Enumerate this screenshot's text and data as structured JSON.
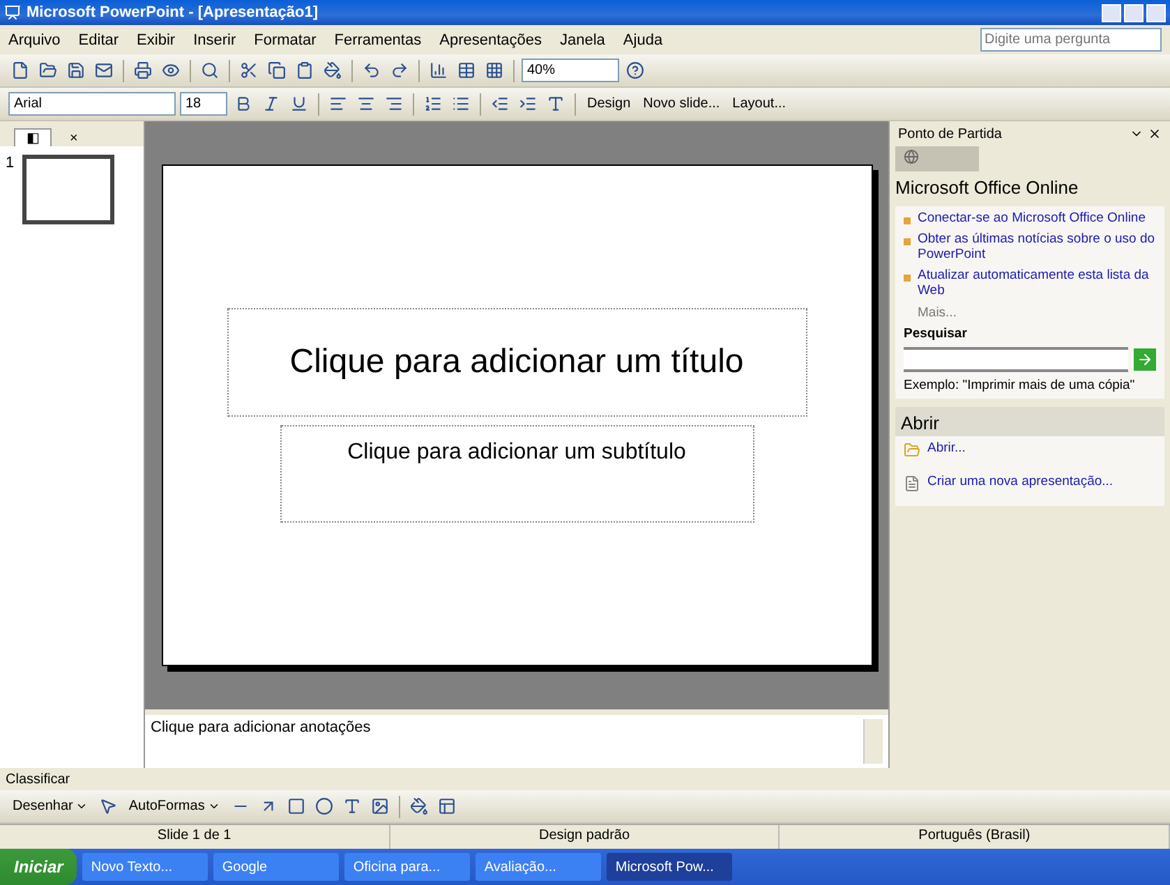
{
  "window": {
    "title": "Microsoft PowerPoint - [Apresentação1]"
  },
  "menu": [
    "Arquivo",
    "Editar",
    "Exibir",
    "Inserir",
    "Formatar",
    "Ferramentas",
    "Apresentações",
    "Janela",
    "Ajuda"
  ],
  "help_box": {
    "placeholder": "Digite uma pergunta"
  },
  "standard_toolbar": {
    "zoom": "40%"
  },
  "formatting_toolbar": {
    "font": "Arial",
    "size": "18",
    "buttons": [
      "Design",
      "Novo slide...",
      "Layout..."
    ]
  },
  "slides_pane": {
    "tabs": [
      {
        "label": "◧",
        "selected": true
      },
      {
        "label": "×",
        "selected": false
      }
    ],
    "slide_number": "1"
  },
  "slide": {
    "title": "Clique para adicionar um título",
    "subtitle": "Clique para adicionar um subtítulo"
  },
  "notes": {
    "placeholder": "Clique para adicionar anotações"
  },
  "task_pane": {
    "title": "Ponto de Partida",
    "heading": "Microsoft Office Online",
    "links": [
      "Conectar-se ao Microsoft Office Online",
      "Obter as últimas notícias sobre o uso do PowerPoint",
      "Atualizar automaticamente esta lista da Web"
    ],
    "more": "Mais...",
    "search_label": "Pesquisar",
    "example": "Exemplo: \"Imprimir mais de uma cópia\"",
    "open_heading": "Abrir",
    "open_links": [
      {
        "kind": "folder",
        "label": "Abrir..."
      },
      {
        "kind": "document",
        "label": "Criar uma nova apresentação..."
      }
    ]
  },
  "view_tabs": {
    "label": "Classificar"
  },
  "drawing_toolbar": {
    "draw": "Desenhar",
    "autoshapes": "AutoFormas"
  },
  "status_bar": [
    "Slide 1 de 1",
    "Design padrão",
    "Português (Brasil)"
  ],
  "taskbar": {
    "start": "Iniciar",
    "items": [
      {
        "label": "Novo Texto...",
        "selected": false
      },
      {
        "label": "Google",
        "selected": false
      },
      {
        "label": "Oficina para...",
        "selected": false
      },
      {
        "label": "Avaliação...",
        "selected": false
      },
      {
        "label": "Microsoft Pow...",
        "selected": true
      }
    ]
  }
}
